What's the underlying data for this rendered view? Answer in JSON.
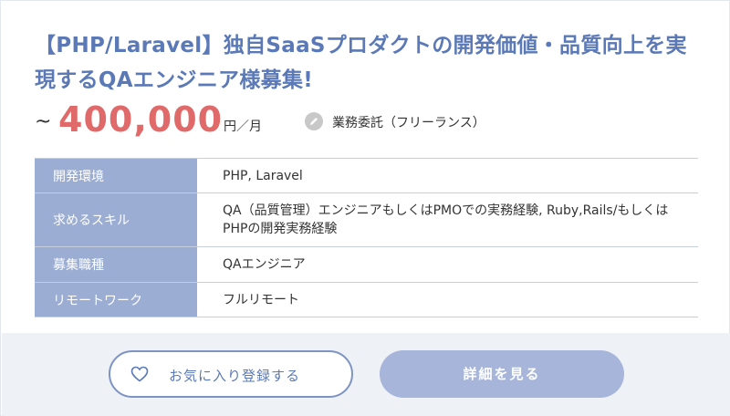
{
  "job": {
    "title": "【PHP/Laravel】独自SaaSプロダクトの開発価値・品質向上を実現するQAエンジニア様募集!",
    "price_prefix": "~",
    "price": "400,000",
    "price_unit": "円／月",
    "contract_type": "業務委託（フリーランス）",
    "contract_icon": "pencil-icon"
  },
  "details": [
    {
      "label": "開発環境",
      "value": "PHP, Laravel"
    },
    {
      "label": "求めるスキル",
      "value": "QA（品質管理）エンジニアもしくはPMOでの実務経験, Ruby,Rails/もしくはPHPの開発実務経験"
    },
    {
      "label": "募集職種",
      "value": "QAエンジニア"
    },
    {
      "label": "リモートワーク",
      "value": "フルリモート"
    }
  ],
  "actions": {
    "favorite_label": "お気に入り登録する",
    "favorite_icon": "heart-icon",
    "detail_label": "詳細を見る"
  },
  "colors": {
    "accent": "#5b79b6",
    "price": "#e06a6a",
    "table_header": "#9badd3",
    "detail_button": "#a6b5d9",
    "footer_bg": "#eef1f6"
  }
}
